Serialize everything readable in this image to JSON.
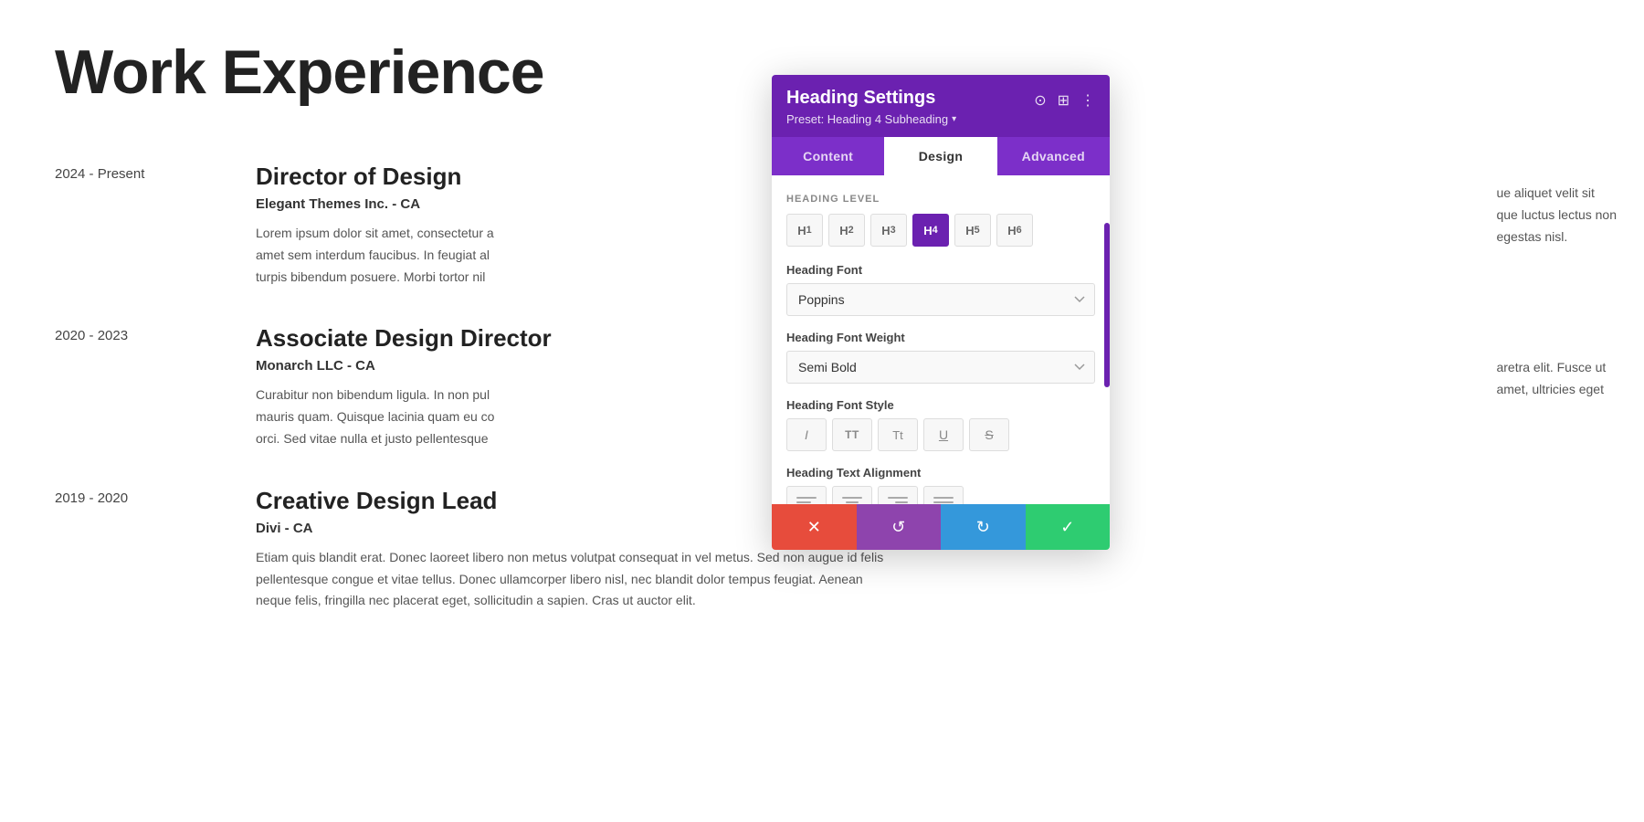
{
  "page": {
    "section_title": "Work Experience",
    "entries": [
      {
        "date": "2024 - Present",
        "title": "Director of Design",
        "company": "Elegant Themes Inc. - CA",
        "description": "Lorem ipsum dolor sit amet, consectetur adipiscing elit. Fusce ut amet sem interdum faucibus. In feugiat aliquam luctus lectus non turpis bibendum posuere. Morbi tortor nisl, egestas nisl."
      },
      {
        "date": "2020 - 2023",
        "title": "Associate Design Director",
        "company": "Monarch LLC - CA",
        "description": "Curabitur non bibendum ligula. In non pulvinar purus. Curabitur nisi aretra elit. Fusce ut mauris quam. Quisque lacinia quam eu condimentum semper. Fusce amet, ultricies eget orci. Sed vitae nulla et justo pellentesque."
      },
      {
        "date": "2019 - 2020",
        "title": "Creative Design Lead",
        "company": "Divi - CA",
        "description": "Etiam quis blandit erat. Donec laoreet libero non metus volutpat consequat in vel metus. Sed non augue id felis pellentesque congue et vitae tellus. Donec ullamcorper libero nisl, nec blandit dolor tempus feugiat. Aenean neque felis, fringilla nec placerat eget, sollicitudin a sapien. Cras ut auctor elit."
      }
    ]
  },
  "panel": {
    "title": "Heading Settings",
    "preset_label": "Preset: Heading 4 Subheading",
    "tabs": [
      {
        "id": "content",
        "label": "Content"
      },
      {
        "id": "design",
        "label": "Design",
        "active": true
      },
      {
        "id": "advanced",
        "label": "Advanced"
      }
    ],
    "heading_level_section": "Heading Level",
    "heading_levels": [
      "H1",
      "H2",
      "H3",
      "H4",
      "H5",
      "H6"
    ],
    "active_heading": "H4",
    "heading_font_label": "Heading Font",
    "heading_font_value": "Poppins",
    "heading_font_weight_label": "Heading Font Weight",
    "heading_font_weight_value": "Semi Bold",
    "heading_font_style_label": "Heading Font Style",
    "heading_text_alignment_label": "Heading Text Alignment",
    "footer_buttons": {
      "cancel": "✕",
      "undo": "↺",
      "redo": "↻",
      "save": "✓"
    }
  },
  "icons": {
    "capture": "⊙",
    "grid": "⊞",
    "menu": "⋮",
    "chevron_down": "▾"
  }
}
